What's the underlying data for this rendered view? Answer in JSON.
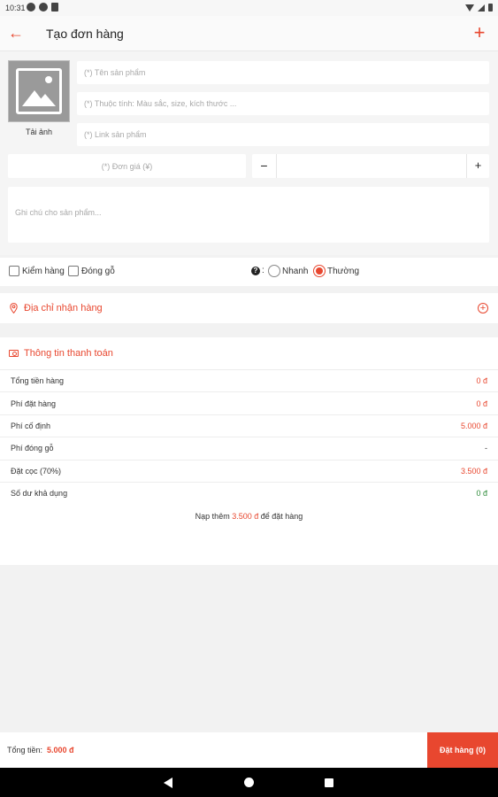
{
  "status_bar": {
    "time": "10:31"
  },
  "app_bar": {
    "title": "Tạo đơn hàng"
  },
  "product": {
    "upload_label": "Tải ảnh",
    "name_placeholder": "(*) Tên sản phẩm",
    "attributes_placeholder": "(*) Thuộc tính: Màu sắc, size, kích thước ...",
    "link_placeholder": "(*) Link sản phẩm",
    "price_placeholder": "(*) Đơn giá (¥)",
    "quantity": "",
    "note_placeholder": "Ghi chú cho sản phẩm..."
  },
  "options": {
    "inspect_label": "Kiểm hàng",
    "crate_label": "Đóng gỗ",
    "colon": ":",
    "fast_label": "Nhanh",
    "normal_label": "Thường",
    "selected_shipping": "Thường"
  },
  "address": {
    "label": "Địa chỉ nhận hàng"
  },
  "payment": {
    "header": "Thông tin thanh toán",
    "rows": [
      {
        "label": "Tổng tiền hàng",
        "value": "0 đ",
        "tone": "red"
      },
      {
        "label": "Phí đặt hàng",
        "value": "0 đ",
        "tone": "red"
      },
      {
        "label": "Phí cố định",
        "value": "5.000 đ",
        "tone": "red"
      },
      {
        "label": "Phí đóng gỗ",
        "value": "-",
        "tone": "plain"
      },
      {
        "label": "Đặt cọc (70%)",
        "value": "3.500 đ",
        "tone": "red"
      },
      {
        "label": "Số dư khả dụng",
        "value": "0 đ",
        "tone": "green"
      }
    ],
    "topup_prefix": "Nạp thêm",
    "topup_amount": "3.500 đ",
    "topup_suffix": "để đặt hàng"
  },
  "bottom": {
    "total_label": "Tổng tiền:",
    "total_value": "5.000 đ",
    "order_button": "Đặt hàng (0)"
  },
  "colors": {
    "accent": "#e8472f",
    "balance": "#2e8b3a"
  }
}
